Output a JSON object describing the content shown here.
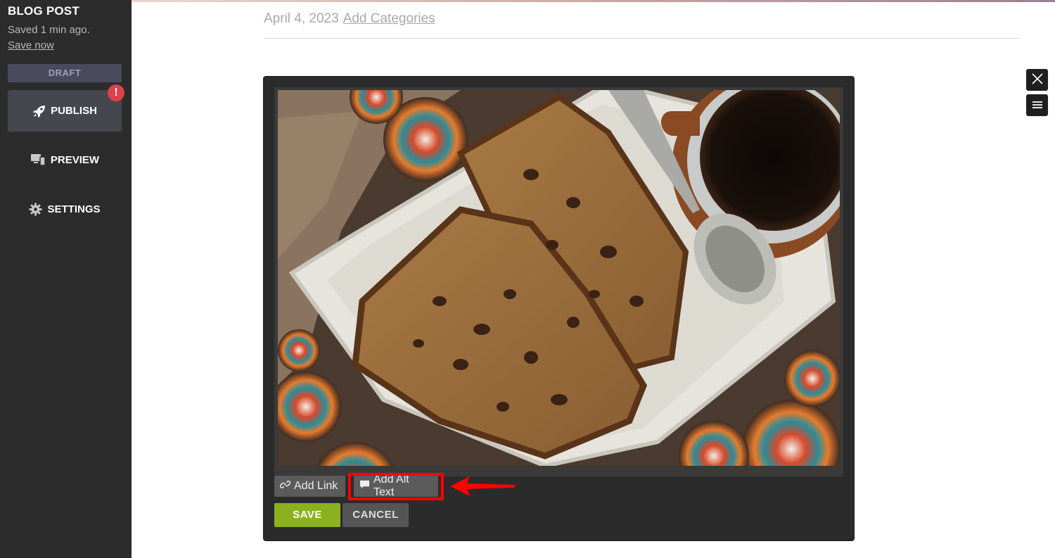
{
  "sidebar": {
    "title": "BLOG POST",
    "saved_text": "Saved 1 min ago.",
    "save_now": "Save now",
    "status_badge": "DRAFT",
    "alert_count": "!",
    "items": [
      {
        "label": "PUBLISH",
        "icon": "rocket-icon"
      },
      {
        "label": "PREVIEW",
        "icon": "monitor-icon"
      },
      {
        "label": "SETTINGS",
        "icon": "gear-icon"
      }
    ]
  },
  "header": {
    "date": "April 4, 2023",
    "categories_link": "Add Categories"
  },
  "image_editor": {
    "add_link_label": "Add Link",
    "add_alt_text_label": "Add Alt Text",
    "save_label": "SAVE",
    "cancel_label": "CANCEL",
    "image_alt": "Sliced banana chocolate chip bread on a white plate next to a spoon and a cup of coffee"
  },
  "colors": {
    "sidebar_bg": "#2c2c2c",
    "save_green": "#8bb21e",
    "highlight_red": "#ff0000",
    "alert_red": "#e0404b"
  }
}
